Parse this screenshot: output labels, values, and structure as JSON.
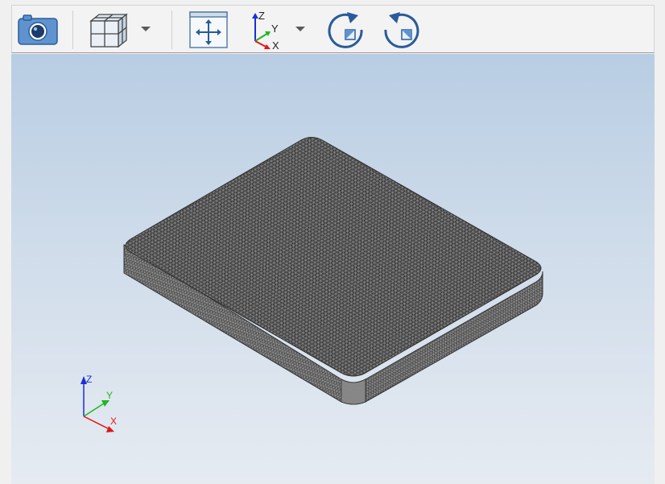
{
  "toolbar": {
    "screenshot_icon": "camera-icon",
    "view_cube_icon": "view-cube-icon",
    "fit_all_icon": "fit-all-icon",
    "axis_icon": "axis-triad-icon",
    "rotate_cw_icon": "rotate-clockwise-icon",
    "rotate_ccw_icon": "rotate-counterclockwise-icon",
    "axis_labels": {
      "z": "Z",
      "y": "Y",
      "x": "X"
    }
  },
  "viewport": {
    "background_top": "#b8cde3",
    "background_bottom": "#e6ebf2",
    "model": "meshed-plate",
    "mesh_color": "#454545",
    "edge_color": "#c8c8c8"
  },
  "triad": {
    "z_label": "Z",
    "y_label": "Y",
    "x_label": "X",
    "z_color": "#1a2fd6",
    "y_color": "#1fb81f",
    "x_color": "#e01818"
  }
}
